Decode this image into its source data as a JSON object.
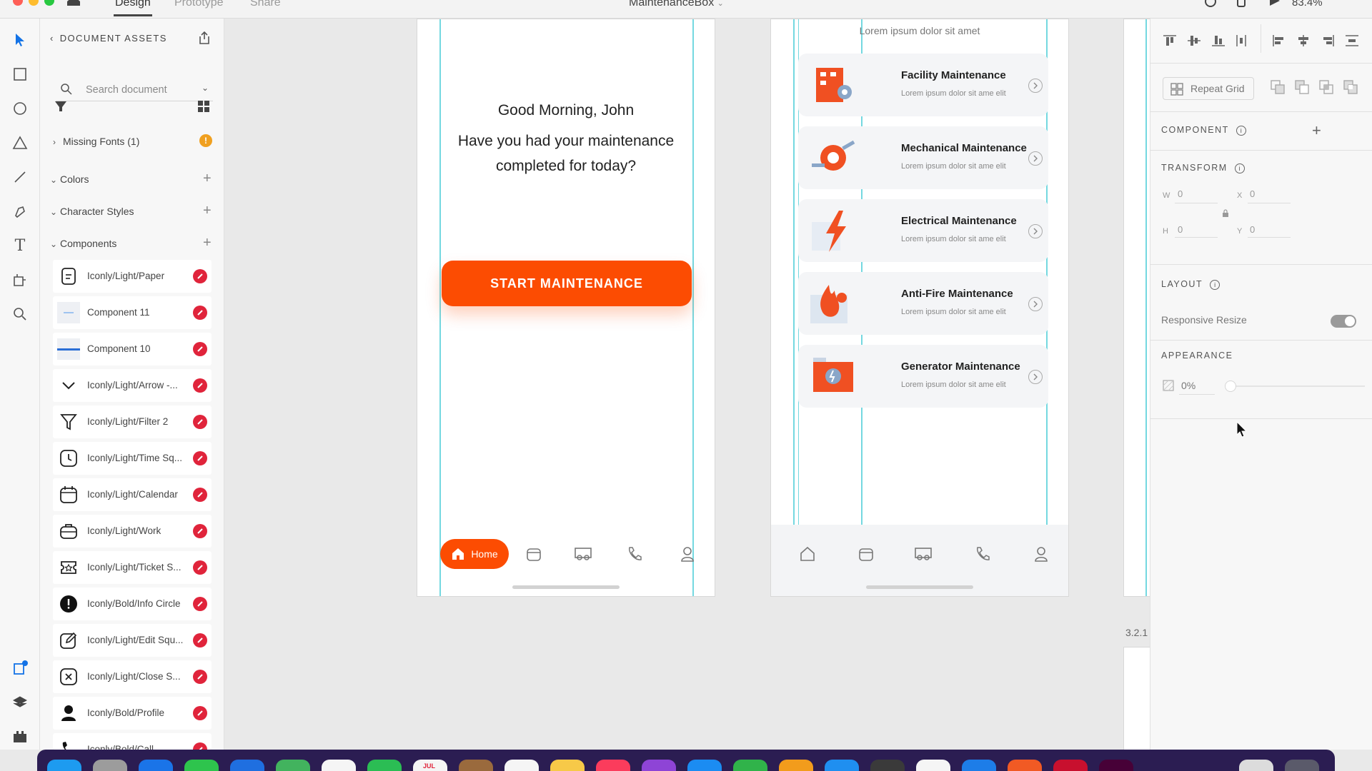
{
  "window": {
    "tabs": [
      "Design",
      "Prototype",
      "Share"
    ],
    "active_tab": "Design",
    "doc_title": "MaintenanceBox",
    "zoom": "83.4%"
  },
  "assets": {
    "header": "DOCUMENT ASSETS",
    "search_placeholder": "Search document",
    "missing_fonts": "Missing Fonts (1)",
    "sections": {
      "colors": "Colors",
      "character_styles": "Character Styles",
      "components": "Components"
    },
    "components": [
      {
        "name": "Iconly/Light/Paper",
        "icon": "paper-icon"
      },
      {
        "name": "Component 11",
        "icon": "line-light-icon"
      },
      {
        "name": "Component 10",
        "icon": "line-blue-icon"
      },
      {
        "name": "Iconly/Light/Arrow -...",
        "icon": "arrow-down-icon"
      },
      {
        "name": "Iconly/Light/Filter 2",
        "icon": "filter-icon"
      },
      {
        "name": "Iconly/Light/Time Sq...",
        "icon": "time-square-icon"
      },
      {
        "name": "Iconly/Light/Calendar",
        "icon": "calendar-icon"
      },
      {
        "name": "Iconly/Light/Work",
        "icon": "work-icon"
      },
      {
        "name": "Iconly/Light/Ticket S...",
        "icon": "ticket-star-icon"
      },
      {
        "name": "Iconly/Bold/Info Circle",
        "icon": "info-circle-icon"
      },
      {
        "name": "Iconly/Light/Edit Squ...",
        "icon": "edit-square-icon"
      },
      {
        "name": "Iconly/Light/Close S...",
        "icon": "close-square-icon"
      },
      {
        "name": "Iconly/Bold/Profile",
        "icon": "profile-icon"
      },
      {
        "name": "Iconly/Bold/Call",
        "icon": "call-icon"
      }
    ]
  },
  "artboard1": {
    "greeting": "Good Morning, John",
    "question_line1": "Have you had your maintenance",
    "question_line2": "completed for today?",
    "cta": "START MAINTENANCE",
    "nav_home": "Home"
  },
  "artboard2": {
    "header": "Lorem ipsum dolor sit amet",
    "cards": [
      {
        "title": "Facility Maintenance",
        "sub": "Lorem ipsum dolor sit ame elit",
        "icon": "facility-icon"
      },
      {
        "title": "Mechanical Maintenance",
        "sub": "Lorem ipsum dolor sit ame elit",
        "icon": "mechanical-icon"
      },
      {
        "title": "Electrical Maintenance",
        "sub": "Lorem ipsum dolor sit ame elit",
        "icon": "electrical-icon"
      },
      {
        "title": "Anti-Fire Maintenance",
        "sub": "Lorem ipsum dolor sit ame elit",
        "icon": "anti-fire-icon"
      },
      {
        "title": "Generator Maintenance",
        "sub": "Lorem ipsum dolor sit ame elit",
        "icon": "generator-icon"
      }
    ]
  },
  "canvas": {
    "artboard_label": "3.2.1"
  },
  "props": {
    "repeat_grid": "Repeat Grid",
    "component": "COMPONENT",
    "transform": "TRANSFORM",
    "w_label": "W",
    "w_value": "0",
    "x_label": "X",
    "x_value": "0",
    "h_label": "H",
    "h_value": "0",
    "y_label": "Y",
    "y_value": "0",
    "layout": "LAYOUT",
    "responsive_resize": "Responsive Resize",
    "responsive_resize_on": true,
    "appearance": "APPEARANCE",
    "opacity": "0%"
  },
  "dock": {
    "calendar_month": "JUL"
  },
  "colors": {
    "accent": "#fc4c02",
    "guide": "#74d8e0",
    "link_badge": "#e0243b",
    "dock": "#2b1d52"
  }
}
